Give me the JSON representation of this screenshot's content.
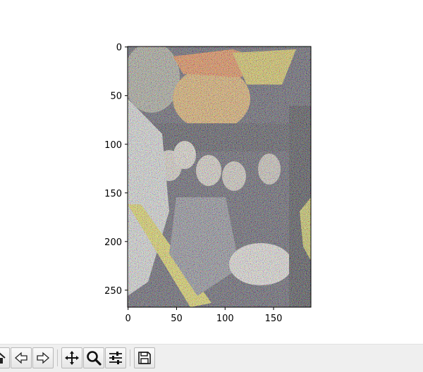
{
  "figure": {
    "x_axis": {
      "ticks": [
        0,
        50,
        100,
        150
      ],
      "range": [
        -0.5,
        188.5
      ]
    },
    "y_axis": {
      "ticks": [
        0,
        50,
        100,
        150,
        200,
        250
      ],
      "range": [
        -0.5,
        267.5
      ],
      "inverted": true
    },
    "image": {
      "description_colors": {
        "background": "#2a2a3a",
        "accent_orange": "#e8742a",
        "accent_yellow": "#e6d84a",
        "light": "#e8e8e0"
      }
    }
  },
  "toolbar": {
    "buttons": [
      {
        "id": "home",
        "icon": "home-icon"
      },
      {
        "id": "back",
        "icon": "back-arrow-icon"
      },
      {
        "id": "forward",
        "icon": "forward-arrow-icon"
      },
      {
        "id": "pan",
        "icon": "move-icon"
      },
      {
        "id": "zoom",
        "icon": "magnifier-icon"
      },
      {
        "id": "configure",
        "icon": "sliders-icon"
      },
      {
        "id": "save",
        "icon": "floppy-disk-icon"
      }
    ]
  }
}
